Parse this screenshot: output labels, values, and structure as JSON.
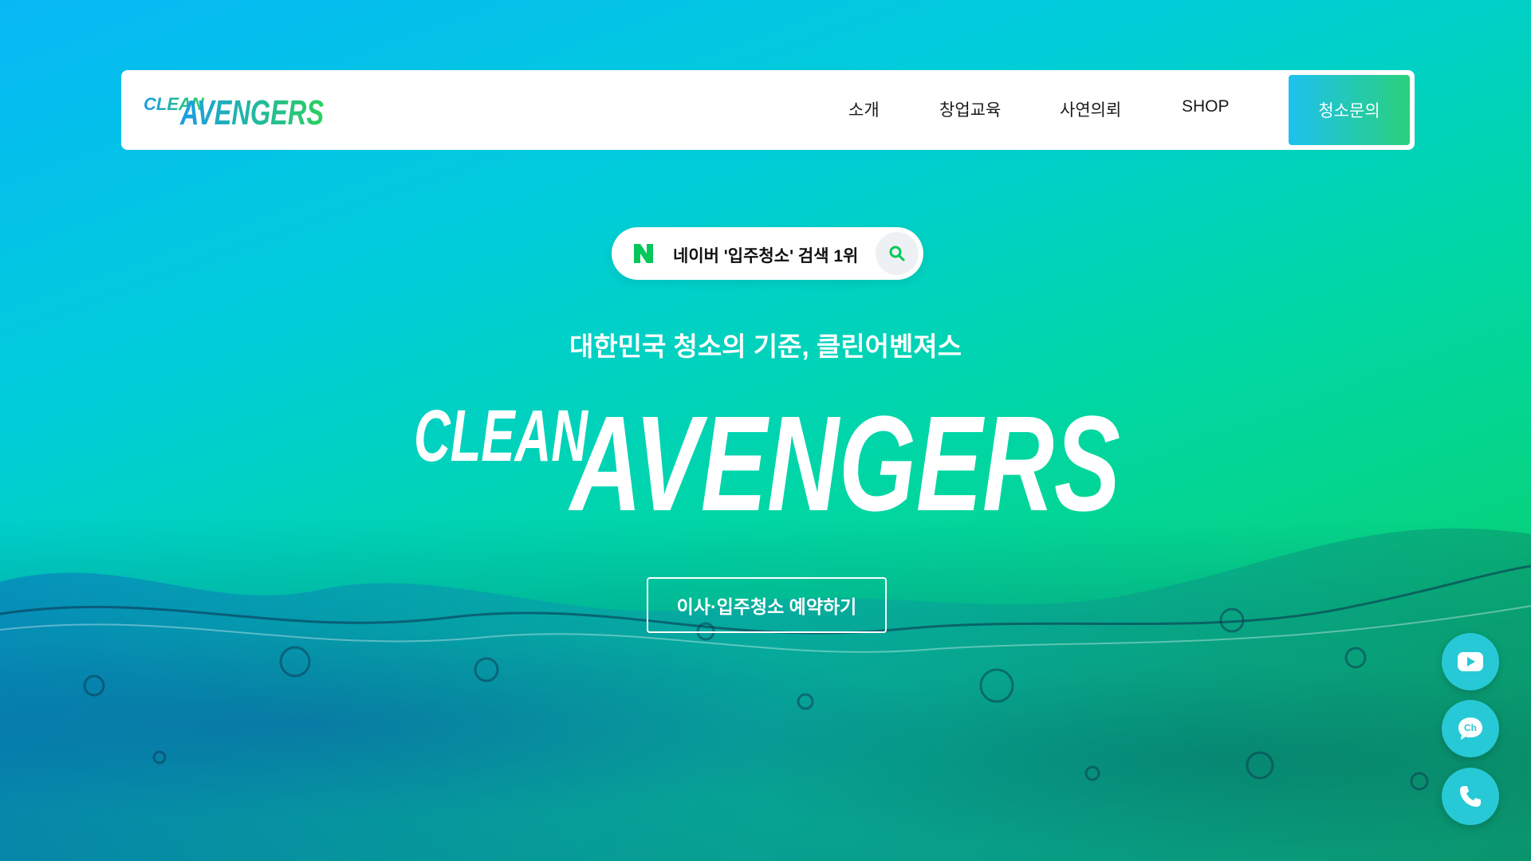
{
  "header": {
    "logo_text_small": "CLEAN",
    "logo_text_big": "AVENGERS",
    "nav": [
      "소개",
      "창업교육",
      "사연의뢰",
      "SHOP"
    ],
    "contact_label": "청소문의"
  },
  "hero": {
    "search_badge": "네이버 '입주청소' 검색 1위",
    "tagline": "대한민국 청소의 기준, 클린어벤져스",
    "logo_text_small": "CLEAN",
    "logo_text_big": "AVENGERS",
    "cta_label": "이사·입주청소 예약하기"
  },
  "floating": [
    {
      "icon": "youtube-icon"
    },
    {
      "icon": "kakao-channel-icon",
      "label": "Ch"
    },
    {
      "icon": "phone-icon"
    }
  ],
  "colors": {
    "gradient_start": "#08b8f6",
    "gradient_end": "#10cf6a",
    "naver_green": "#03c75a",
    "float_btn": "#28c9d6"
  }
}
